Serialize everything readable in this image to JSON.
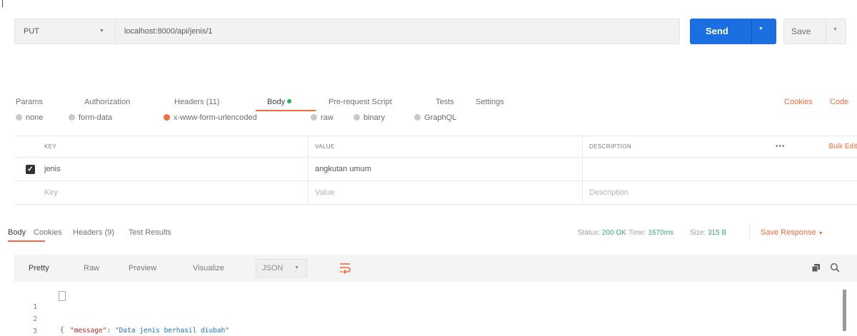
{
  "request": {
    "method": "PUT",
    "url": "localhost:8000/api/jenis/1",
    "send_label": "Send",
    "save_label": "Save"
  },
  "request_tabs": [
    {
      "label": "Params"
    },
    {
      "label": "Authorization"
    },
    {
      "label": "Headers (11)"
    },
    {
      "label": "Body"
    },
    {
      "label": "Pre-request Script"
    },
    {
      "label": "Tests"
    },
    {
      "label": "Settings"
    }
  ],
  "top_links": {
    "cookies": "Cookies",
    "code": "Code"
  },
  "body_types": [
    {
      "label": "none"
    },
    {
      "label": "form-data"
    },
    {
      "label": "x-www-form-urlencoded"
    },
    {
      "label": "raw"
    },
    {
      "label": "binary"
    },
    {
      "label": "GraphQL"
    }
  ],
  "params_table": {
    "headers": {
      "key": "KEY",
      "value": "VALUE",
      "description": "DESCRIPTION"
    },
    "more": "•••",
    "bulk_edit": "Bulk Edit",
    "rows": [
      {
        "key": "jenis",
        "value": "angkutan umum",
        "description": "",
        "checked": true
      }
    ],
    "placeholder": {
      "key": "Key",
      "value": "Value",
      "description": "Description"
    }
  },
  "response_tabs": [
    {
      "label": "Body"
    },
    {
      "label": "Cookies"
    },
    {
      "label": "Headers (9)"
    },
    {
      "label": "Test Results"
    }
  ],
  "status": {
    "status_label": "Status:",
    "status_value": "200 OK",
    "time_label": "Time:",
    "time_value": "1670ms",
    "size_label": "Size:",
    "size_value": "315 B",
    "save_response": "Save Response"
  },
  "format_buttons": [
    {
      "label": "Pretty"
    },
    {
      "label": "Raw"
    },
    {
      "label": "Preview"
    },
    {
      "label": "Visualize"
    }
  ],
  "language": "JSON",
  "code_lines": [
    {
      "num": "1",
      "text": "{"
    },
    {
      "num": "2",
      "key": "\"message\"",
      "colon": ": ",
      "value": "\"Data jenis berhasil diubah\""
    },
    {
      "num": "3",
      "text": "}"
    }
  ],
  "colors": {
    "accent": "#f26b3a",
    "send": "#1b6fe0",
    "status_ok": "#3bad69"
  }
}
